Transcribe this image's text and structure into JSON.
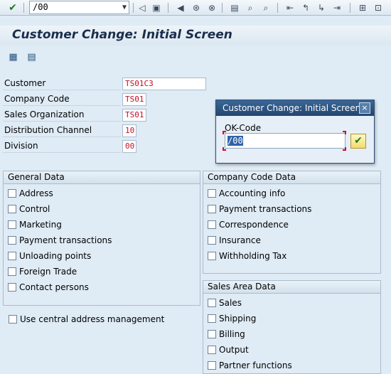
{
  "toolbar": {
    "okcode_value": "/00",
    "enter_icon": "green-check-icon",
    "icons": [
      "back-icon",
      "save-icon",
      "back-nav-icon",
      "exit-icon",
      "cancel-icon",
      "print-icon",
      "find-icon",
      "find-next-icon",
      "first-page-icon",
      "previous-page-icon",
      "next-page-icon",
      "last-page-icon",
      "new-session-icon",
      "shortcut-icon"
    ]
  },
  "title": "Customer Change: Initial Screen",
  "app_toolbar": {
    "icons": [
      "customer-list-icon",
      "additional-data-icon"
    ]
  },
  "fields": [
    {
      "label": "Customer",
      "value": "TS01C3"
    },
    {
      "label": "Company Code",
      "value": "TS01"
    },
    {
      "label": "Sales Organization",
      "value": "TS01"
    },
    {
      "label": "Distribution Channel",
      "value": "10"
    },
    {
      "label": "Division",
      "value": "00"
    }
  ],
  "general_data": {
    "title": "General Data",
    "items": [
      "Address",
      "Control",
      "Marketing",
      "Payment transactions",
      "Unloading points",
      "Foreign Trade",
      "Contact persons"
    ]
  },
  "company_code_data": {
    "title": "Company Code Data",
    "items": [
      "Accounting info",
      "Payment transactions",
      "Correspondence",
      "Insurance",
      "Withholding Tax"
    ]
  },
  "sales_area_data": {
    "title": "Sales Area Data",
    "items": [
      "Sales",
      "Shipping",
      "Billing",
      "Output",
      "Partner functions"
    ]
  },
  "central_address": "Use central address management",
  "dialog": {
    "title": "Customer Change: Initial Screen",
    "label": "OK-Code",
    "value": "/00",
    "close": "×",
    "ok": "✔"
  },
  "colors": {
    "background": "#dfebf5",
    "input_value_text": "#c0102a",
    "dialog_title": "#2b4d77",
    "active_field_border": "#f0a000"
  }
}
